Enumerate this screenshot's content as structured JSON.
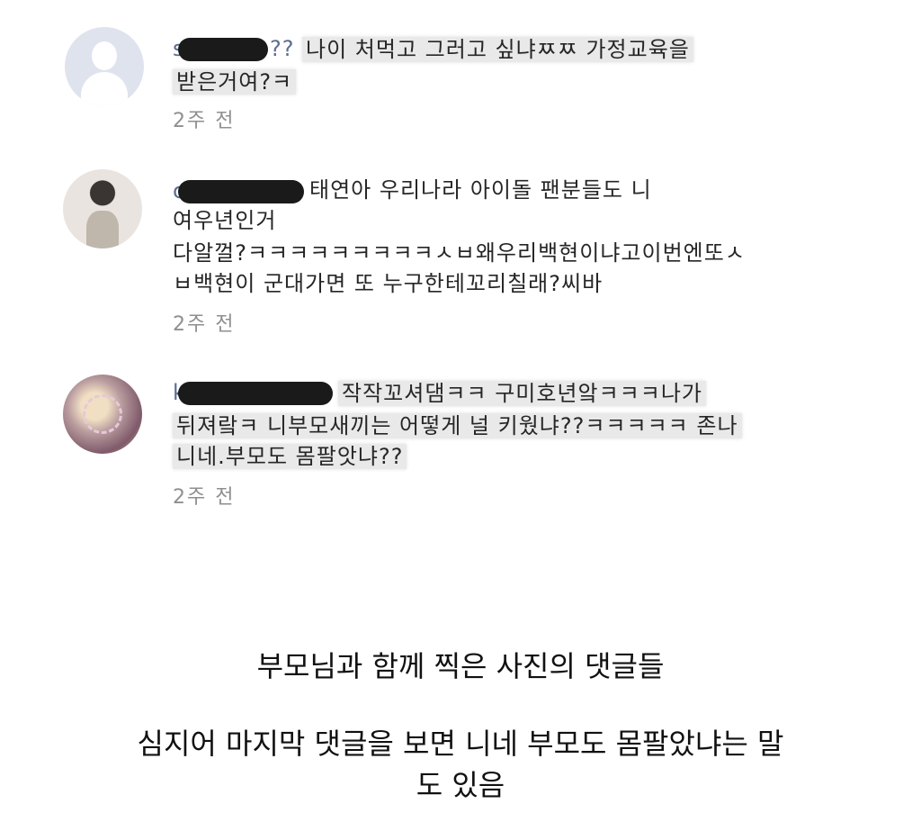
{
  "comments": [
    {
      "username": "s",
      "username_tail": "??",
      "lines": [
        "나이 처먹고 그러고 싶냐ㅉㅉ 가정교육을",
        "받은거여?ㅋ"
      ],
      "timestamp": "2주 전",
      "avatar": "default-profile-icon"
    },
    {
      "username": "c",
      "lines": [
        "태연아 우리나라 아이돌 팬분들도 니",
        "여우년인거",
        "다알껄?ㅋㅋㅋㅋㅋㅋㅋㅋㅋㅅㅂ왜우리백현이냐고이번엔또ㅅ",
        "ㅂ백현이 군대가면  또 누구한테꼬리칠래?씨바"
      ],
      "timestamp": "2주 전",
      "avatar": "profile-photo"
    },
    {
      "username": "k",
      "lines": [
        "작작꼬셔댐ㅋㅋ 구미호년앜ㅋㅋㅋ나가",
        "뒤져랔ㅋ 니부모새끼는 어떻게 널 키웠냐??ㅋㅋㅋㅋㅋ 존나",
        "니네.부모도 몸팔앗냐??"
      ],
      "timestamp": "2주 전",
      "avatar": "profile-photo"
    }
  ],
  "caption": {
    "line1": "부모님과 함께 찍은 사진의 댓글들",
    "line2": "심지어 마지막 댓글을 보면 니네 부모도 몸팔았냐는 말",
    "line3": "도 있음"
  }
}
